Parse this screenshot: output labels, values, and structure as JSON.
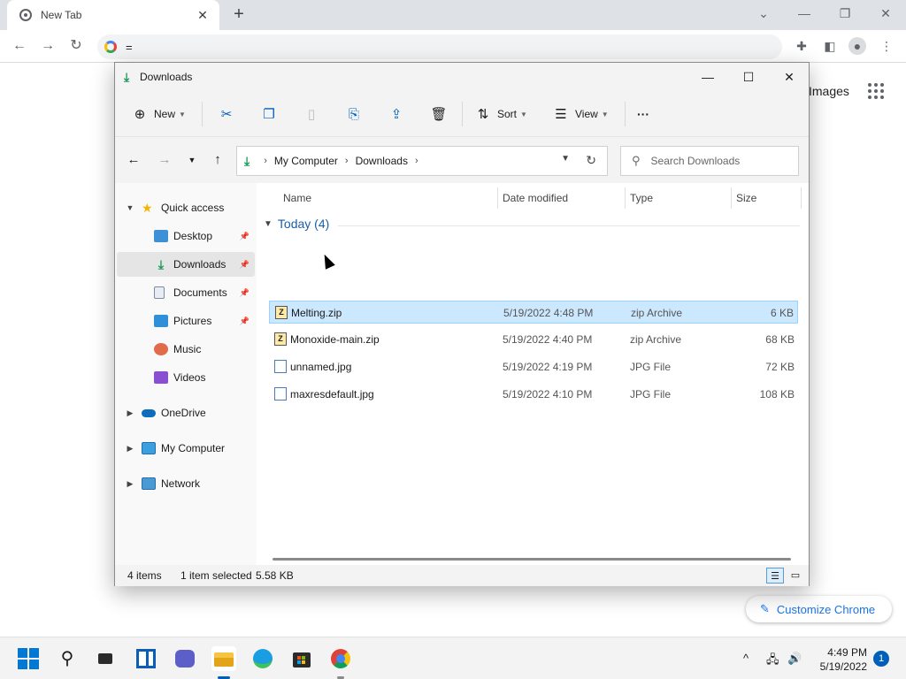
{
  "chrome": {
    "tab_title": "New Tab",
    "tab_close": "✕",
    "new_tab": "+",
    "omnibox_text": "=",
    "images_link": "Images",
    "customize_label": "Customize Chrome"
  },
  "explorer": {
    "title": "Downloads",
    "commands": {
      "new_label": "New",
      "sort_label": "Sort",
      "view_label": "View",
      "more_label": "···"
    },
    "address": {
      "root": "My Computer",
      "current": "Downloads"
    },
    "search_placeholder": "Search Downloads",
    "nav": {
      "quick_access": "Quick access",
      "desktop": "Desktop",
      "downloads": "Downloads",
      "documents": "Documents",
      "pictures": "Pictures",
      "music": "Music",
      "videos": "Videos",
      "onedrive": "OneDrive",
      "my_computer": "My Computer",
      "network": "Network"
    },
    "columns": {
      "name": "Name",
      "date": "Date modified",
      "type": "Type",
      "size": "Size"
    },
    "group_label": "Today (4)",
    "files": [
      {
        "name": "Melting.zip",
        "date": "5/19/2022 4:48 PM",
        "type": "zip Archive",
        "size": "6 KB",
        "kind": "zip",
        "selected": true
      },
      {
        "name": "Monoxide-main.zip",
        "date": "5/19/2022 4:40 PM",
        "type": "zip Archive",
        "size": "68 KB",
        "kind": "zip",
        "selected": false
      },
      {
        "name": "unnamed.jpg",
        "date": "5/19/2022 4:19 PM",
        "type": "JPG File",
        "size": "72 KB",
        "kind": "jpg",
        "selected": false
      },
      {
        "name": "maxresdefault.jpg",
        "date": "5/19/2022 4:10 PM",
        "type": "JPG File",
        "size": "108 KB",
        "kind": "jpg",
        "selected": false
      }
    ],
    "status": {
      "count": "4 items",
      "selected": "1 item selected",
      "size": "5.58 KB"
    }
  },
  "taskbar": {
    "time": "4:49 PM",
    "date": "5/19/2022",
    "notifications": "1"
  }
}
